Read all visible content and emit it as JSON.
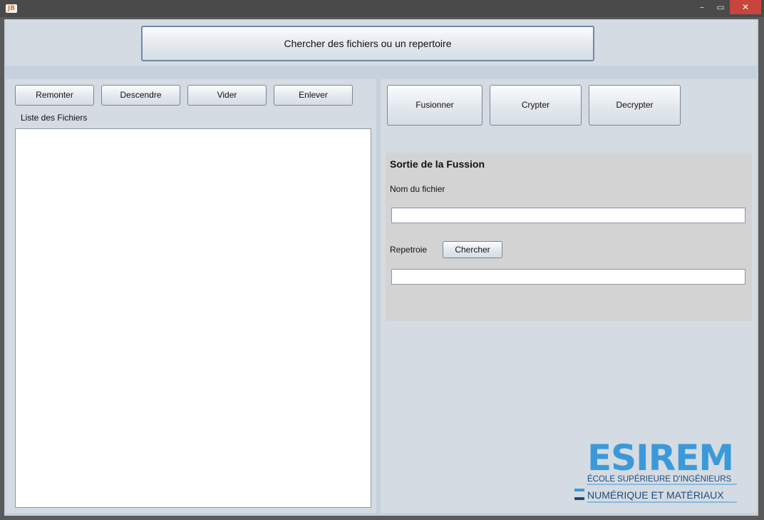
{
  "window": {
    "app_icon_text": "JB",
    "controls": {
      "minimize": "–",
      "maximize": "▭",
      "close": "✕"
    }
  },
  "top": {
    "browse_label": "Chercher des fichiers ou un repertoire"
  },
  "left": {
    "buttons": [
      "Remonter",
      "Descendre",
      "Vider",
      "Enlever"
    ],
    "list_label": "Liste des Fichiers"
  },
  "right": {
    "buttons": [
      "Fusionner",
      "Crypter",
      "Decrypter"
    ],
    "output": {
      "title": "Sortie de la Fussion",
      "filename_label": "Nom du fichier",
      "filename_value": "",
      "directory_label": "Repetroie",
      "browse_label": "Chercher",
      "directory_value": ""
    }
  },
  "logo": {
    "name": "ESIREM",
    "line1": "ÉCOLE SUPÉRIEURE D'INGÉNIEURS",
    "line2": "NUMÉRIQUE ET MATÉRIAUX"
  },
  "colors": {
    "accent": "#3a9ad9",
    "logo_dark": "#1a4d80",
    "close": "#c7453c"
  }
}
